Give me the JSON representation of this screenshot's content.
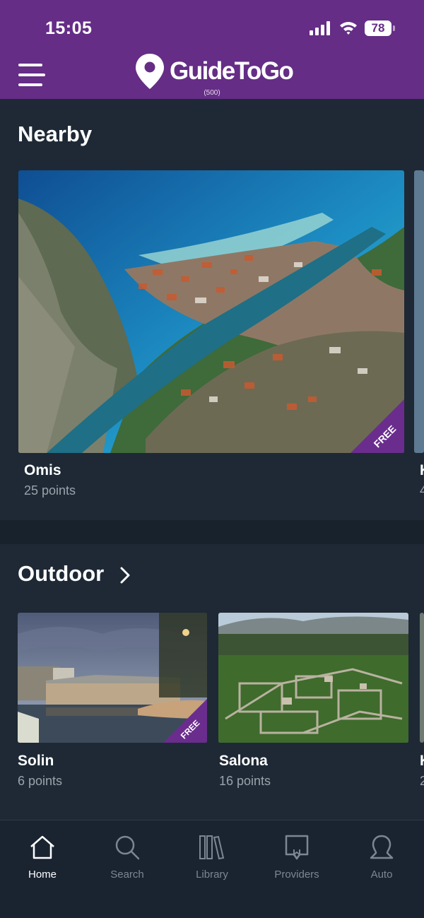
{
  "status_bar": {
    "time": "15:05",
    "battery": "78"
  },
  "header": {
    "logo_text": "GuideToGo",
    "count": "(500)"
  },
  "nearby": {
    "title": "Nearby",
    "items": [
      {
        "title": "Omis",
        "subtitle": "25 points",
        "badge": "FREE"
      },
      {
        "title": "K",
        "subtitle": "4"
      }
    ]
  },
  "outdoor": {
    "title": "Outdoor",
    "items": [
      {
        "title": "Solin",
        "subtitle": "6 points",
        "badge": "FREE"
      },
      {
        "title": "Salona",
        "subtitle": "16 points"
      },
      {
        "title": "K",
        "subtitle": "2"
      }
    ]
  },
  "tabs": [
    {
      "label": "Home",
      "icon": "home-icon",
      "active": true
    },
    {
      "label": "Search",
      "icon": "search-icon"
    },
    {
      "label": "Library",
      "icon": "library-icon"
    },
    {
      "label": "Providers",
      "icon": "providers-icon"
    },
    {
      "label": "Auto",
      "icon": "auto-icon"
    }
  ],
  "colors": {
    "brand": "#652d86",
    "background": "#1e2935",
    "badge": "#6a2d8d"
  }
}
